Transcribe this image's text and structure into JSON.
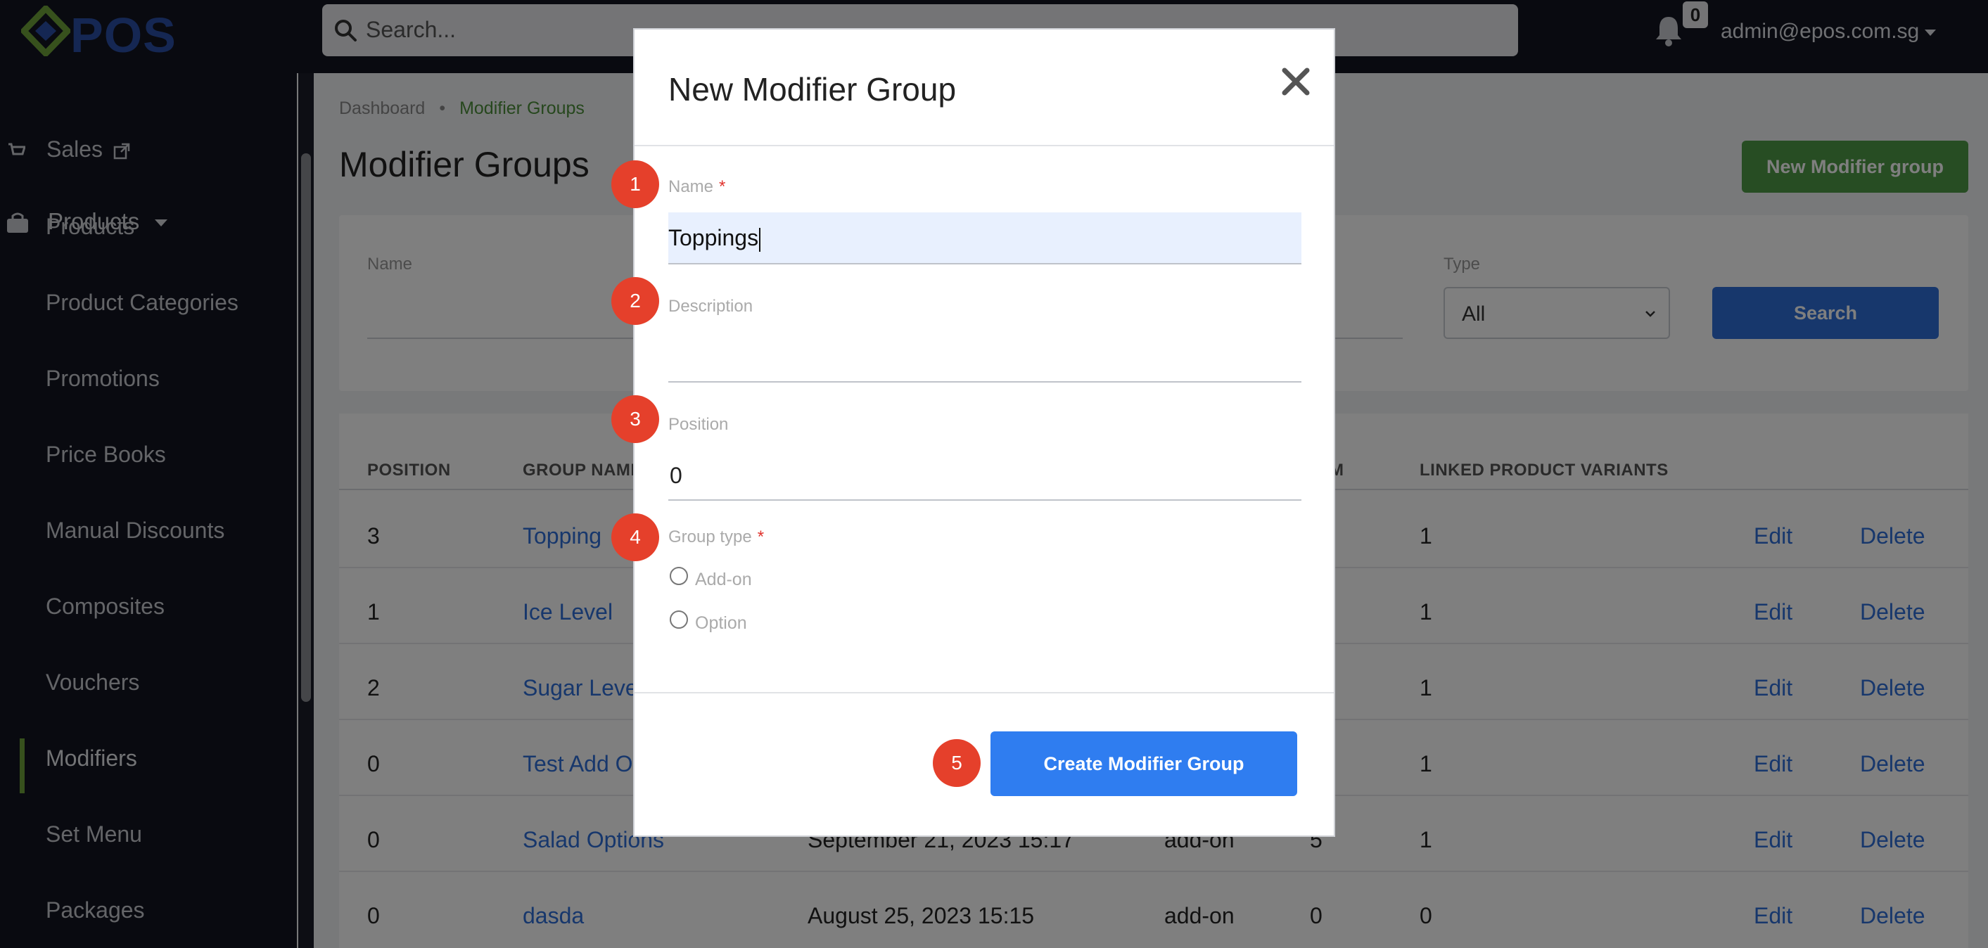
{
  "brand": {
    "logo_text": "POS"
  },
  "topbar": {
    "search_placeholder": "Search...",
    "notification_count": "0",
    "user_email": "admin@epos.com.sg"
  },
  "sidebar": {
    "sales_label": "Sales",
    "products_section": "Products",
    "items": [
      {
        "label": "Products"
      },
      {
        "label": "Product Categories"
      },
      {
        "label": "Promotions"
      },
      {
        "label": "Price Books"
      },
      {
        "label": "Manual Discounts"
      },
      {
        "label": "Composites"
      },
      {
        "label": "Vouchers"
      },
      {
        "label": "Modifiers",
        "active": true
      },
      {
        "label": "Set Menu"
      },
      {
        "label": "Packages"
      }
    ]
  },
  "page": {
    "breadcrumb": [
      "Dashboard",
      "Modifier Groups"
    ],
    "title": "Modifier Groups",
    "new_button": "New Modifier group"
  },
  "filters": {
    "name_label": "Name",
    "type_label": "Type",
    "type_value": "All",
    "search_button": "Search"
  },
  "table": {
    "headers": {
      "position": "POSITION",
      "group_name": "GROUP NAME",
      "item": "M",
      "linked": "LINKED PRODUCT VARIANTS"
    },
    "rows": [
      {
        "position": "3",
        "name": "Topping",
        "created": "",
        "type": "",
        "items": "",
        "linked": "1",
        "edit": "Edit",
        "delete": "Delete"
      },
      {
        "position": "1",
        "name": "Ice Level",
        "created": "",
        "type": "",
        "items": "",
        "linked": "1",
        "edit": "Edit",
        "delete": "Delete"
      },
      {
        "position": "2",
        "name": "Sugar Leve",
        "created": "",
        "type": "",
        "items": "",
        "linked": "1",
        "edit": "Edit",
        "delete": "Delete"
      },
      {
        "position": "0",
        "name": "Test Add O",
        "created": "",
        "type": "",
        "items": "",
        "linked": "1",
        "edit": "Edit",
        "delete": "Delete"
      },
      {
        "position": "0",
        "name": "Salad Options",
        "created": "September 21, 2023 15:17",
        "type": "add-on",
        "items": "5",
        "linked": "1",
        "edit": "Edit",
        "delete": "Delete"
      },
      {
        "position": "0",
        "name": "dasda",
        "created": "August 25, 2023 15:15",
        "type": "add-on",
        "items": "0",
        "linked": "0",
        "edit": "Edit",
        "delete": "Delete"
      }
    ]
  },
  "modal": {
    "title": "New Modifier Group",
    "name_label": "Name",
    "required_mark": "*",
    "name_value": "Toppings",
    "description_label": "Description",
    "position_label": "Position",
    "position_value": "0",
    "group_type_label": "Group type",
    "options": [
      "Add-on",
      "Option"
    ],
    "create_button": "Create Modifier Group"
  },
  "step_badges": [
    "1",
    "2",
    "3",
    "4",
    "5"
  ],
  "colors": {
    "topbar_bg": "#131520",
    "accent_blue": "#2f7df0",
    "green_button": "#4f9a47",
    "badge_red": "#e5402b"
  }
}
